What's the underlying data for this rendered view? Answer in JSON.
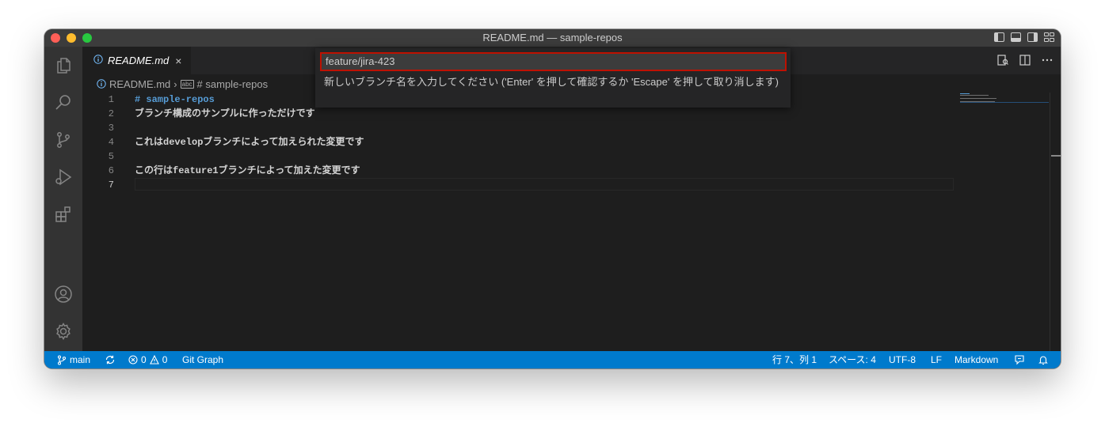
{
  "window": {
    "title": "README.md — sample-repos"
  },
  "activity_bar": {
    "items": [
      "files-icon",
      "search-icon",
      "source-control-icon",
      "run-debug-icon",
      "extensions-icon"
    ],
    "bottom": [
      "account-icon",
      "settings-gear-icon"
    ]
  },
  "tab": {
    "label": "README.md",
    "icon": "info-icon",
    "close": "×"
  },
  "breadcrumbs": {
    "file": "README.md",
    "separator": "›",
    "symbol_icon": "abc",
    "symbol": "# sample-repos"
  },
  "editor": {
    "lines": [
      {
        "num": "1",
        "text": "# sample-repos"
      },
      {
        "num": "2",
        "text": "ブランチ構成のサンプルに作っただけです"
      },
      {
        "num": "3",
        "text": ""
      },
      {
        "num": "4",
        "text": "これはdevelopブランチによって加えられた変更です"
      },
      {
        "num": "5",
        "text": ""
      },
      {
        "num": "6",
        "text": "この行はfeature1ブランチによって加えた変更です"
      },
      {
        "num": "7",
        "text": ""
      }
    ]
  },
  "quick_input": {
    "value": "feature/jira-423",
    "message": "新しいブランチ名を入力してください ('Enter' を押して確認するか 'Escape' を押して取り消します)"
  },
  "status_bar": {
    "branch": "main",
    "errors": "0",
    "warnings": "0",
    "git_graph": "Git Graph",
    "position": "行 7、列 1",
    "spaces": "スペース: 4",
    "encoding": "UTF-8",
    "eol": "LF",
    "language": "Markdown"
  },
  "colors": {
    "accent": "#007acc",
    "input_border": "#be1100",
    "heading": "#569cd6"
  }
}
